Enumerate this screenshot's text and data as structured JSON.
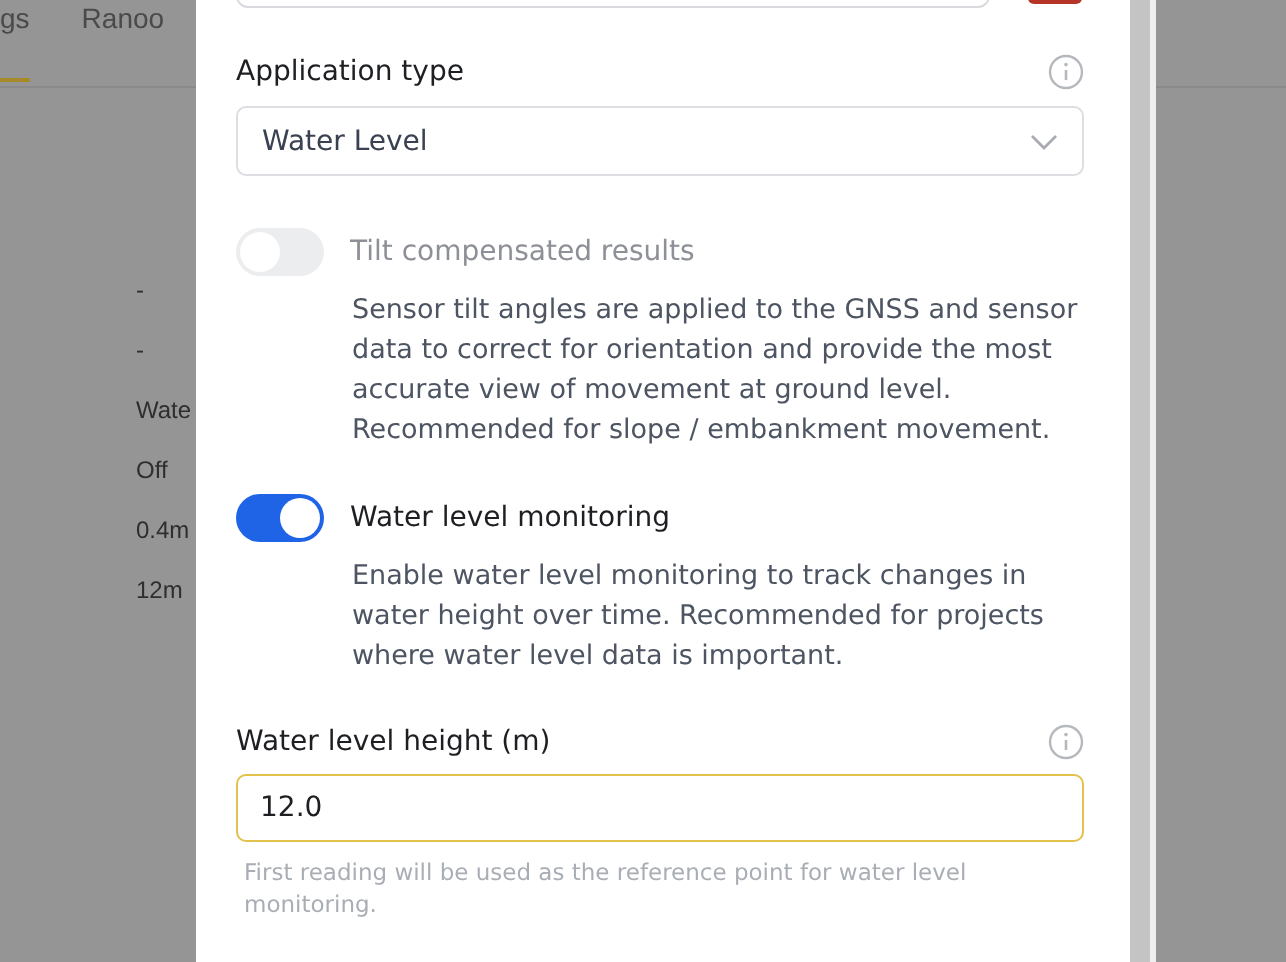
{
  "background": {
    "tabs": [
      {
        "label": "gs",
        "selected": true
      },
      {
        "label": "Ranoo",
        "selected": false
      }
    ],
    "values": [
      "-",
      "-",
      "Wate",
      "Off",
      "0.4m",
      "12m"
    ]
  },
  "modal": {
    "application_type": {
      "label": "Application type",
      "value": "Water Level"
    },
    "toggles": [
      {
        "label": "Tilt compensated results",
        "on": false,
        "disabled": true,
        "description": "Sensor tilt angles are applied to the GNSS and sensor data to correct for orientation and provide the most accurate view of movement at ground level. Recommended for slope / embankment movement."
      },
      {
        "label": "Water level monitoring",
        "on": true,
        "disabled": false,
        "description": "Enable water level monitoring to track changes in water height over time. Recommended for projects where water level data is important."
      }
    ],
    "water_level_height": {
      "label": "Water level height (m)",
      "value": "12.0",
      "focused": true,
      "hint": "First reading will be used as the reference point for water level monitoring."
    }
  }
}
